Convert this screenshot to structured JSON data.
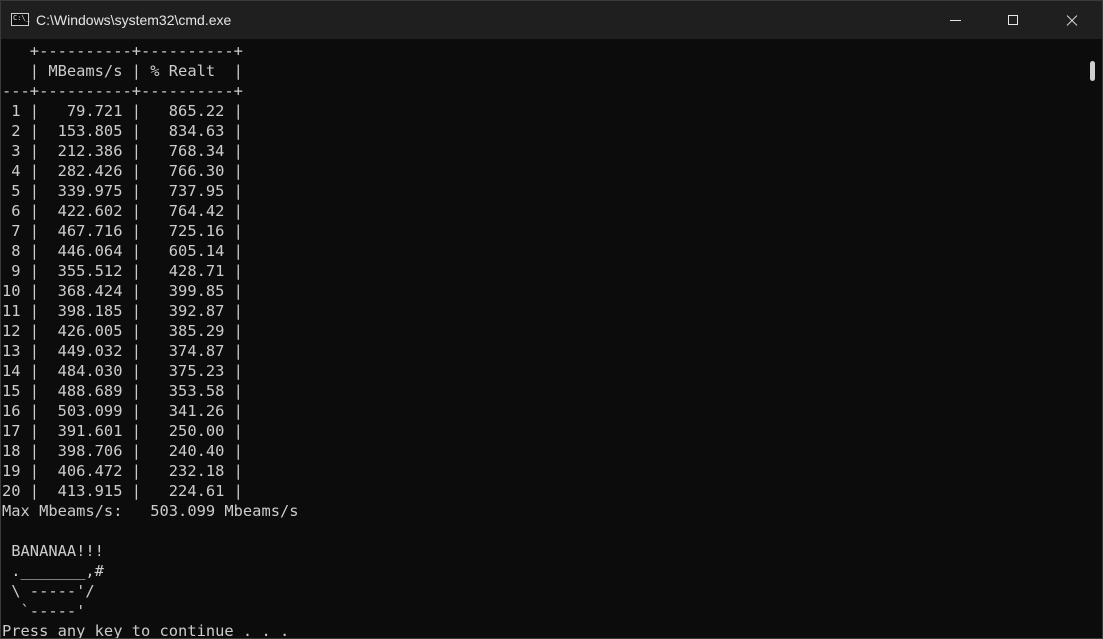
{
  "window": {
    "title": "C:\\Windows\\system32\\cmd.exe",
    "app_icon_text": "C:\\_"
  },
  "console": {
    "lines": [
      "   +----------+----------+",
      "   | MBeams/s | % Realt  |",
      "---+----------+----------+",
      " 1 |   79.721 |   865.22 |",
      " 2 |  153.805 |   834.63 |",
      " 3 |  212.386 |   768.34 |",
      " 4 |  282.426 |   766.30 |",
      " 5 |  339.975 |   737.95 |",
      " 6 |  422.602 |   764.42 |",
      " 7 |  467.716 |   725.16 |",
      " 8 |  446.064 |   605.14 |",
      " 9 |  355.512 |   428.71 |",
      "10 |  368.424 |   399.85 |",
      "11 |  398.185 |   392.87 |",
      "12 |  426.005 |   385.29 |",
      "13 |  449.032 |   374.87 |",
      "14 |  484.030 |   375.23 |",
      "15 |  488.689 |   353.58 |",
      "16 |  503.099 |   341.26 |",
      "17 |  391.601 |   250.00 |",
      "18 |  398.706 |   240.40 |",
      "19 |  406.472 |   232.18 |",
      "20 |  413.915 |   224.61 |",
      "Max Mbeams/s:   503.099 Mbeams/s",
      "",
      " BANANAA!!!",
      " ._______,#",
      " \\ -----'/",
      "  `-----'",
      "Press any key to continue . . ."
    ]
  }
}
